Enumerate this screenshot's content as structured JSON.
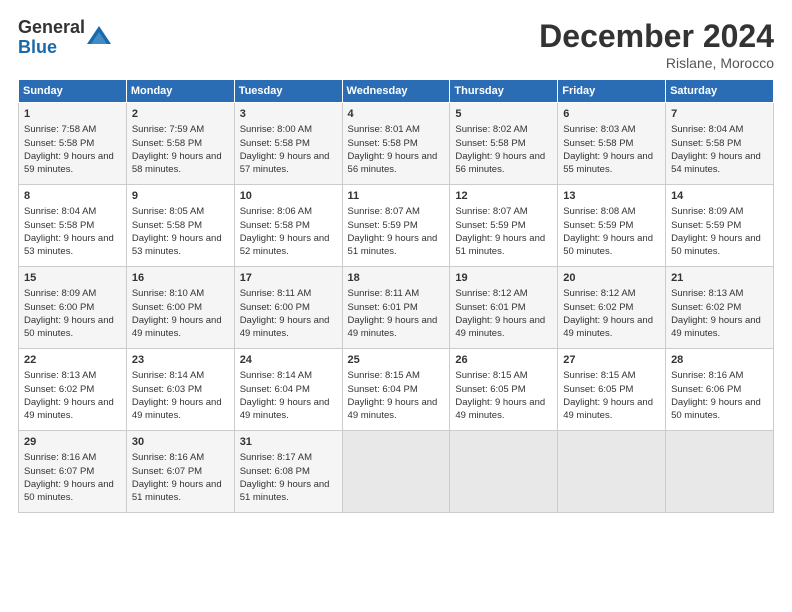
{
  "logo": {
    "line1": "General",
    "line2": "Blue"
  },
  "title": {
    "month": "December 2024",
    "location": "Rislane, Morocco"
  },
  "weekdays": [
    "Sunday",
    "Monday",
    "Tuesday",
    "Wednesday",
    "Thursday",
    "Friday",
    "Saturday"
  ],
  "weeks": [
    [
      {
        "day": "1",
        "content": "Sunrise: 7:58 AM\nSunset: 5:58 PM\nDaylight: 9 hours and 59 minutes."
      },
      {
        "day": "2",
        "content": "Sunrise: 7:59 AM\nSunset: 5:58 PM\nDaylight: 9 hours and 58 minutes."
      },
      {
        "day": "3",
        "content": "Sunrise: 8:00 AM\nSunset: 5:58 PM\nDaylight: 9 hours and 57 minutes."
      },
      {
        "day": "4",
        "content": "Sunrise: 8:01 AM\nSunset: 5:58 PM\nDaylight: 9 hours and 56 minutes."
      },
      {
        "day": "5",
        "content": "Sunrise: 8:02 AM\nSunset: 5:58 PM\nDaylight: 9 hours and 56 minutes."
      },
      {
        "day": "6",
        "content": "Sunrise: 8:03 AM\nSunset: 5:58 PM\nDaylight: 9 hours and 55 minutes."
      },
      {
        "day": "7",
        "content": "Sunrise: 8:04 AM\nSunset: 5:58 PM\nDaylight: 9 hours and 54 minutes."
      }
    ],
    [
      {
        "day": "8",
        "content": "Sunrise: 8:04 AM\nSunset: 5:58 PM\nDaylight: 9 hours and 53 minutes."
      },
      {
        "day": "9",
        "content": "Sunrise: 8:05 AM\nSunset: 5:58 PM\nDaylight: 9 hours and 53 minutes."
      },
      {
        "day": "10",
        "content": "Sunrise: 8:06 AM\nSunset: 5:58 PM\nDaylight: 9 hours and 52 minutes."
      },
      {
        "day": "11",
        "content": "Sunrise: 8:07 AM\nSunset: 5:59 PM\nDaylight: 9 hours and 51 minutes."
      },
      {
        "day": "12",
        "content": "Sunrise: 8:07 AM\nSunset: 5:59 PM\nDaylight: 9 hours and 51 minutes."
      },
      {
        "day": "13",
        "content": "Sunrise: 8:08 AM\nSunset: 5:59 PM\nDaylight: 9 hours and 50 minutes."
      },
      {
        "day": "14",
        "content": "Sunrise: 8:09 AM\nSunset: 5:59 PM\nDaylight: 9 hours and 50 minutes."
      }
    ],
    [
      {
        "day": "15",
        "content": "Sunrise: 8:09 AM\nSunset: 6:00 PM\nDaylight: 9 hours and 50 minutes."
      },
      {
        "day": "16",
        "content": "Sunrise: 8:10 AM\nSunset: 6:00 PM\nDaylight: 9 hours and 49 minutes."
      },
      {
        "day": "17",
        "content": "Sunrise: 8:11 AM\nSunset: 6:00 PM\nDaylight: 9 hours and 49 minutes."
      },
      {
        "day": "18",
        "content": "Sunrise: 8:11 AM\nSunset: 6:01 PM\nDaylight: 9 hours and 49 minutes."
      },
      {
        "day": "19",
        "content": "Sunrise: 8:12 AM\nSunset: 6:01 PM\nDaylight: 9 hours and 49 minutes."
      },
      {
        "day": "20",
        "content": "Sunrise: 8:12 AM\nSunset: 6:02 PM\nDaylight: 9 hours and 49 minutes."
      },
      {
        "day": "21",
        "content": "Sunrise: 8:13 AM\nSunset: 6:02 PM\nDaylight: 9 hours and 49 minutes."
      }
    ],
    [
      {
        "day": "22",
        "content": "Sunrise: 8:13 AM\nSunset: 6:02 PM\nDaylight: 9 hours and 49 minutes."
      },
      {
        "day": "23",
        "content": "Sunrise: 8:14 AM\nSunset: 6:03 PM\nDaylight: 9 hours and 49 minutes."
      },
      {
        "day": "24",
        "content": "Sunrise: 8:14 AM\nSunset: 6:04 PM\nDaylight: 9 hours and 49 minutes."
      },
      {
        "day": "25",
        "content": "Sunrise: 8:15 AM\nSunset: 6:04 PM\nDaylight: 9 hours and 49 minutes."
      },
      {
        "day": "26",
        "content": "Sunrise: 8:15 AM\nSunset: 6:05 PM\nDaylight: 9 hours and 49 minutes."
      },
      {
        "day": "27",
        "content": "Sunrise: 8:15 AM\nSunset: 6:05 PM\nDaylight: 9 hours and 49 minutes."
      },
      {
        "day": "28",
        "content": "Sunrise: 8:16 AM\nSunset: 6:06 PM\nDaylight: 9 hours and 50 minutes."
      }
    ],
    [
      {
        "day": "29",
        "content": "Sunrise: 8:16 AM\nSunset: 6:07 PM\nDaylight: 9 hours and 50 minutes."
      },
      {
        "day": "30",
        "content": "Sunrise: 8:16 AM\nSunset: 6:07 PM\nDaylight: 9 hours and 51 minutes."
      },
      {
        "day": "31",
        "content": "Sunrise: 8:17 AM\nSunset: 6:08 PM\nDaylight: 9 hours and 51 minutes."
      },
      {
        "day": "",
        "content": ""
      },
      {
        "day": "",
        "content": ""
      },
      {
        "day": "",
        "content": ""
      },
      {
        "day": "",
        "content": ""
      }
    ]
  ]
}
